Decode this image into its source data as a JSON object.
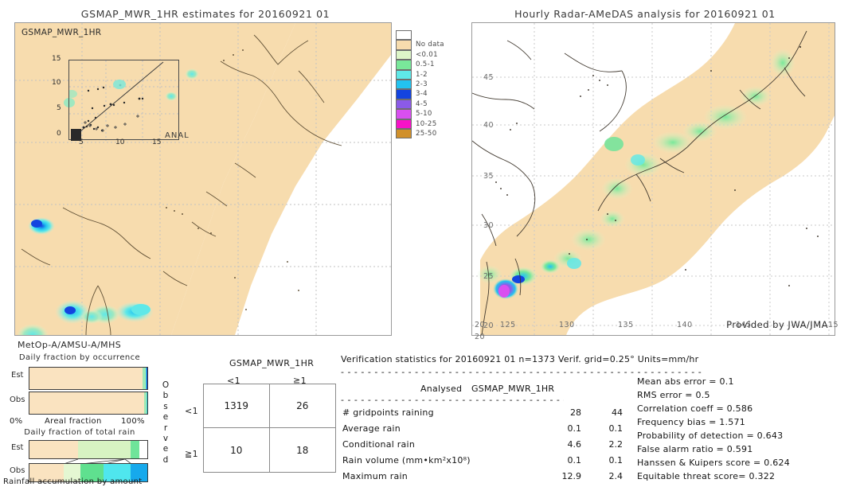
{
  "left_panel": {
    "title": "GSMAP_MWR_1HR estimates for 20160921 01",
    "corner_label": "GSMAP_MWR_1HR",
    "inset": {
      "anal_label": "ANAL",
      "y_ticks": [
        "15",
        "10",
        "5",
        "0"
      ],
      "x_ticks": [
        "5",
        "10",
        "15"
      ]
    },
    "sensor_label": "MetOp-A/AMSU-A/MHS"
  },
  "right_panel": {
    "title": "Hourly Radar-AMeDAS analysis for 20160921 01",
    "x_ticks": [
      "125",
      "130",
      "135",
      "140",
      "145",
      "15"
    ],
    "y_ticks": [
      "45",
      "40",
      "35",
      "30",
      "25",
      "20"
    ],
    "extra_tick": "20",
    "credit": "Provided by JWA/JMA"
  },
  "colorbar": {
    "swatches": [
      {
        "color": "#ffffff",
        "label": ""
      },
      {
        "color": "#f7dcae",
        "label": "No data"
      },
      {
        "color": "#ddf5c8",
        "label": "<0.01"
      },
      {
        "color": "#79e89a",
        "label": "0.5-1"
      },
      {
        "color": "#5fe8e8",
        "label": "1-2"
      },
      {
        "color": "#22c3f0",
        "label": "2-3"
      },
      {
        "color": "#1344e0",
        "label": "3-4"
      },
      {
        "color": "#8b5ae8",
        "label": "4-5"
      },
      {
        "color": "#d94ff0",
        "label": "5-10"
      },
      {
        "color": "#f712c8",
        "label": "10-25"
      },
      {
        "color": "#d0902b",
        "label": "25-50"
      }
    ]
  },
  "occurrence_chart": {
    "title": "Daily fraction by occurrence",
    "rows": [
      {
        "label": "Est",
        "segments": [
          {
            "color": "#fae3c0",
            "pct": 96.2
          },
          {
            "color": "#9fe8b5",
            "pct": 2.3
          },
          {
            "color": "#3fd9e0",
            "pct": 1.0
          },
          {
            "color": "#1344e0",
            "pct": 0.5
          }
        ]
      },
      {
        "label": "Obs",
        "segments": [
          {
            "color": "#fae3c0",
            "pct": 97.6
          },
          {
            "color": "#9fe8b5",
            "pct": 1.6
          },
          {
            "color": "#3fd9e0",
            "pct": 0.8
          }
        ]
      }
    ],
    "axis_left": "0%",
    "axis_center": "Areal fraction",
    "axis_right": "100%"
  },
  "total_rain_chart": {
    "title": "Daily fraction of total rain",
    "rows": [
      {
        "label": "Est",
        "segments": [
          {
            "color": "#fae3c0",
            "pct": 41.0
          },
          {
            "color": "#d7f3c2",
            "pct": 45.0
          },
          {
            "color": "#6fe49a",
            "pct": 7.0
          },
          {
            "color": "#ffffff",
            "pct": 7.0
          }
        ]
      },
      {
        "label": "Obs",
        "segments": [
          {
            "color": "#fae3c0",
            "pct": 29.0
          },
          {
            "color": "#e4f7d2",
            "pct": 14.0
          },
          {
            "color": "#5fe08f",
            "pct": 20.0
          },
          {
            "color": "#4fe6ee",
            "pct": 23.0
          },
          {
            "color": "#16a9ec",
            "pct": 14.0
          }
        ]
      }
    ],
    "axis_label": "Rainfall accumulation by amount"
  },
  "contingency": {
    "column_title": "GSMAP_MWR_1HR",
    "col_headers": [
      "<1",
      "≧1"
    ],
    "row_headers": [
      "<1",
      "≧1"
    ],
    "side_label": "Observed",
    "cells": [
      [
        "1319",
        "26"
      ],
      [
        "10",
        "18"
      ]
    ]
  },
  "verification": {
    "header": "Verification statistics for 20160921 01  n=1373  Verif. grid=0.25°  Units=mm/hr",
    "divider": "- - - - - - - - - - - - - - - - - - - - - - - - - - - - - - - - - - - - - - - - - - - - - - - - - - - - - -",
    "col_headers": [
      "Analysed",
      "GSMAP_MWR_1HR"
    ],
    "rows": [
      {
        "label": "# gridpoints raining",
        "analysed": "28",
        "estimate": "44"
      },
      {
        "label": "Average rain",
        "analysed": "0.1",
        "estimate": "0.1"
      },
      {
        "label": "Conditional rain",
        "analysed": "4.6",
        "estimate": "2.2"
      },
      {
        "label": "Rain volume (mm•km²x10⁸)",
        "analysed": "0.1",
        "estimate": "0.1"
      },
      {
        "label": "Maximum rain",
        "analysed": "12.9",
        "estimate": "2.4"
      }
    ],
    "scores": [
      "Mean abs error = 0.1",
      "RMS error = 0.5",
      "Correlation coeff = 0.586",
      "Frequency bias = 1.571",
      "Probability of detection = 0.643",
      "False alarm ratio = 0.591",
      "Hanssen & Kuipers score = 0.624",
      "Equitable threat score= 0.322"
    ]
  }
}
